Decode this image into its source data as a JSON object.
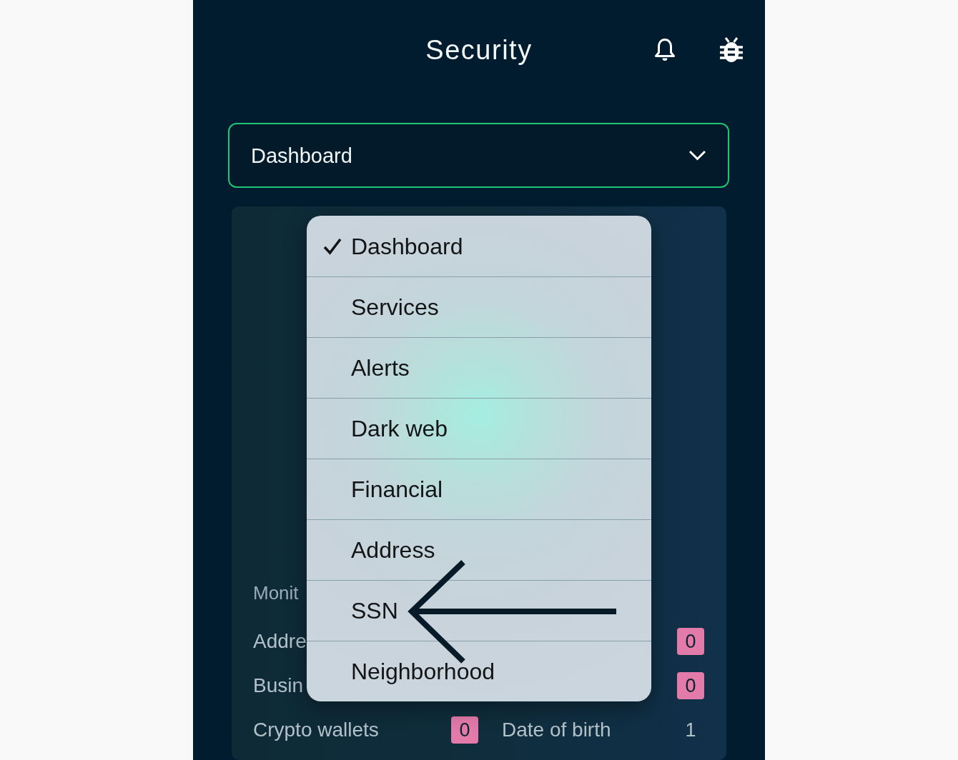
{
  "header": {
    "title": "Security"
  },
  "view_select": {
    "value": "Dashboard",
    "expanded": true
  },
  "menu": {
    "items": [
      {
        "label": "Dashboard",
        "selected": true,
        "marked": false
      },
      {
        "label": "Services",
        "selected": false,
        "marked": false
      },
      {
        "label": "Alerts",
        "selected": false,
        "marked": false
      },
      {
        "label": "Dark web",
        "selected": false,
        "marked": false
      },
      {
        "label": "Financial",
        "selected": false,
        "marked": false
      },
      {
        "label": "Address",
        "selected": false,
        "marked": false
      },
      {
        "label": "SSN",
        "selected": false,
        "marked": true
      },
      {
        "label": "Neighborhood",
        "selected": false,
        "marked": false
      }
    ]
  },
  "monitoring": {
    "heading": "Monit",
    "items": [
      {
        "label": "Addre"
      },
      {
        "count": "0",
        "kind": "badge"
      },
      {
        "label": "Busin"
      },
      {
        "count": "0",
        "kind": "badge"
      },
      {
        "label": "Crypto wallets",
        "count": "0",
        "kind": "badge"
      },
      {
        "label": "Date of birth",
        "count": "1",
        "kind": "plain"
      }
    ]
  }
}
